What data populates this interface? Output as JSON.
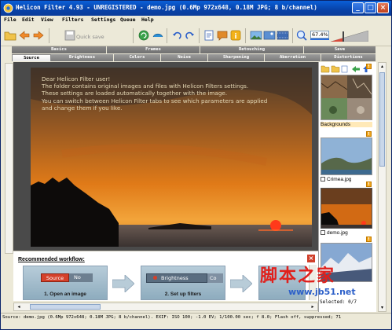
{
  "window": {
    "title": "Helicon Filter 4.93 - UNREGISTERED - demo.jpg (0.6Mp 972x648, 0.18M JPG; 8 b/channel)",
    "controls": [
      "minimize",
      "maximize",
      "close"
    ]
  },
  "menu": [
    "File",
    "Edit",
    "View",
    "Filters",
    "Settings",
    "Queue",
    "Help"
  ],
  "toolbar": {
    "quick_save_label": "Quick save",
    "zoom_value": "67.4%",
    "icons": [
      "open-folder-icon",
      "back-arrow-icon",
      "forward-arrow-icon",
      "save-icon",
      "refresh-icon",
      "compare-icon",
      "undo-icon",
      "redo-icon",
      "page-icon",
      "comment-icon",
      "info-icon",
      "landscape-icon",
      "image-icon",
      "film-icon",
      "zoom-icon"
    ]
  },
  "tabs": {
    "row1": [
      "Basics",
      "Frames",
      "Retouching",
      "Save"
    ],
    "row2": [
      "Source",
      "Brightness",
      "Colors",
      "Noise",
      "Sharpening",
      "Aberration",
      "Distortions"
    ],
    "active": "Source"
  },
  "viewer": {
    "overlay_lines": [
      "Dear Helicon Filter user!",
      "The folder contains original images and files with Helicon Filters settings.",
      "These settings are loaded automatically together with the image.",
      "You can switch between Helicon Filter tabs to see which parameters are applied",
      "and change them if you like."
    ]
  },
  "workflow": {
    "title": "Recommended workflow:",
    "steps": [
      {
        "caption": "1. Open an image",
        "tab_label": "Source",
        "tab_label2": "No"
      },
      {
        "caption": "2. Set up filters",
        "tab_label": "Brightness",
        "tab_label2": "Co"
      }
    ]
  },
  "browser": {
    "folders": [
      {
        "label": "Backgrounds"
      },
      {
        "label": "Crimea.jpg"
      },
      {
        "label": "demo.jpg"
      }
    ],
    "selected_info": "Selected: 0/7"
  },
  "status": {
    "text": "Source: demo.jpg (0.6Mp 972x648; 0.18M JPG; 8 b/channel).  EXIF: ISO 100; -1.0 EV; 1/100.00 sec; f 8.0; Flash off, suppressed; 71"
  },
  "watermark": {
    "main": "脚本之家",
    "url": "www.jb51.net"
  },
  "colors": {
    "title_bar": "#0842a8",
    "tab_inactive": "#7a7a7a",
    "tab_active": "#ffffff",
    "viewer_bg": "#4a4a4a",
    "watermark_red": "#e0201c",
    "watermark_blue": "#2b5fc9"
  }
}
